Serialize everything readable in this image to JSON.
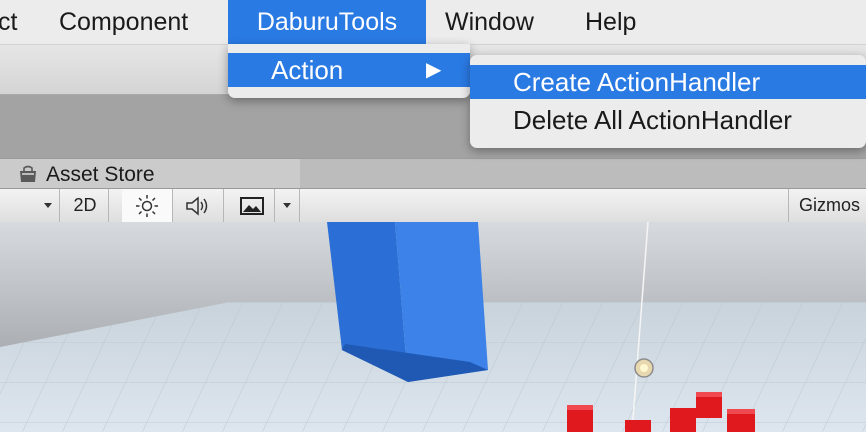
{
  "menubar": {
    "items": [
      "ct",
      "Component",
      "DaburuTools",
      "Window",
      "Help"
    ],
    "active_index": 2
  },
  "submenu_dabur": {
    "items": [
      {
        "label": "Action",
        "has_submenu": true,
        "highlighted": true
      }
    ],
    "arrow": "▶"
  },
  "submenu_action": {
    "items": [
      {
        "label": "Create ActionHandler",
        "highlighted": true
      },
      {
        "label": "Delete All ActionHandler",
        "highlighted": false
      }
    ]
  },
  "tab": {
    "label": "Asset Store",
    "icon": "shop-icon"
  },
  "scene_toolbar": {
    "mode_2d": "2D",
    "gizmos": "Gizmos",
    "icons": [
      "dropdown-arrow-icon",
      "sun-icon",
      "speaker-icon",
      "image-icon",
      "dropdown-arrow-icon"
    ]
  },
  "colors": {
    "highlight": "#2a7ae4",
    "cube_blue": "#2b6fd6",
    "cube_red": "#e0191f"
  }
}
